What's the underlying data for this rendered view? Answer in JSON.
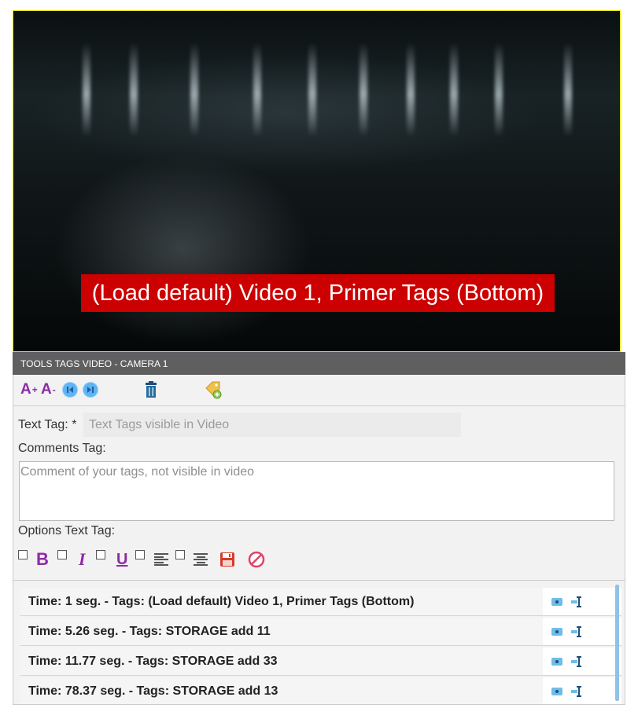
{
  "video": {
    "caption": "(Load default) Video 1, Primer Tags (Bottom)"
  },
  "panel": {
    "title": "TOOLS TAGS VIDEO - CAMERA 1"
  },
  "toolbar": {
    "font_increase": "A",
    "font_increase_sup": "+",
    "font_decrease": "A",
    "font_decrease_sup": "-",
    "icons": [
      "font-increase-icon",
      "font-decrease-icon",
      "previous-icon",
      "next-icon",
      "trash-icon",
      "tag-add-icon"
    ]
  },
  "form": {
    "text_tag_label": "Text Tag: *",
    "text_tag_placeholder": "Text Tags visible in Video",
    "text_tag_value": "",
    "comments_label": "Comments Tag:",
    "comments_placeholder": "Comment of your tags, not visible in video",
    "comments_value": "",
    "options_label": "Options Text Tag:",
    "bold": "B",
    "italic": "I",
    "underline": "U"
  },
  "tags": [
    {
      "text": "Time: 1 seg. - Tags: (Load default) Video 1, Primer Tags (Bottom)"
    },
    {
      "text": "Time: 5.26 seg. - Tags: STORAGE  add 11"
    },
    {
      "text": "Time: 11.77 seg. - Tags: STORAGE  add 33"
    },
    {
      "text": "Time: 78.37 seg. - Tags: STORAGE  add 13"
    }
  ],
  "colors": {
    "caption_bg": "#cc0000",
    "accent": "#8e2aa8",
    "header_bg": "#5f5f5f",
    "video_border": "#e8e400"
  }
}
